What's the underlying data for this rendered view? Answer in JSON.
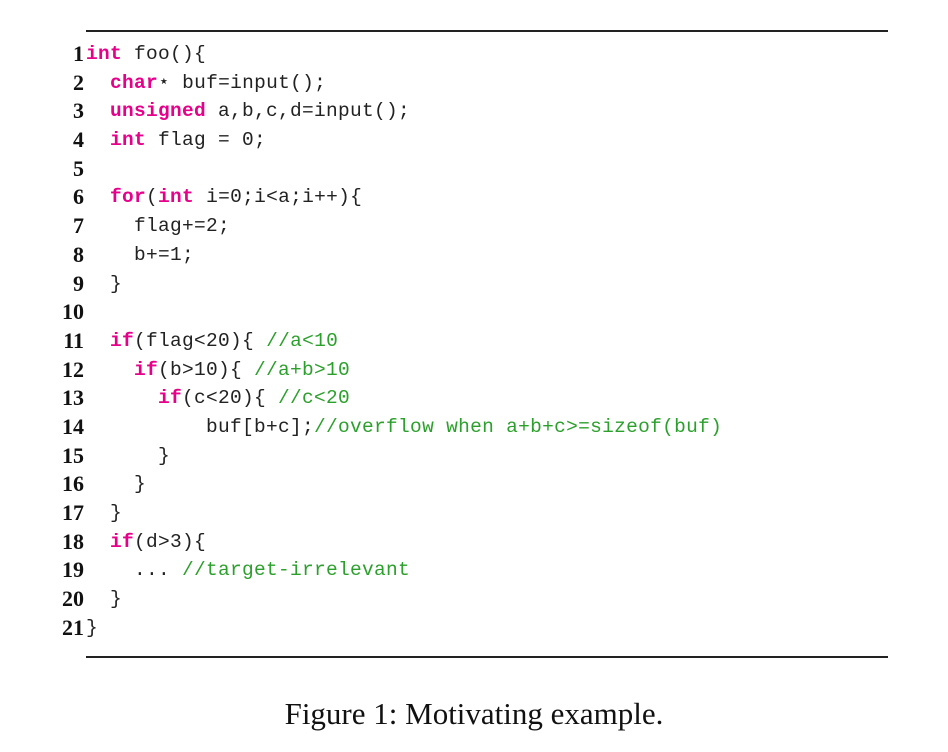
{
  "figure": {
    "caption": "Figure 1: Motivating example.",
    "colors": {
      "keyword": "#e6008a",
      "comment": "#2ca02c",
      "text": "#222222"
    },
    "code_lines": [
      {
        "n": "1",
        "tokens": [
          {
            "t": "int",
            "k": "kw"
          },
          {
            "t": " foo(){",
            "k": ""
          }
        ]
      },
      {
        "n": "2",
        "tokens": [
          {
            "t": "  ",
            "k": ""
          },
          {
            "t": "char",
            "k": "kw"
          },
          {
            "t": "⋆ buf=input();",
            "k": ""
          }
        ]
      },
      {
        "n": "3",
        "tokens": [
          {
            "t": "  ",
            "k": ""
          },
          {
            "t": "unsigned",
            "k": "kw"
          },
          {
            "t": " a,b,c,d=input();",
            "k": ""
          }
        ]
      },
      {
        "n": "4",
        "tokens": [
          {
            "t": "  ",
            "k": ""
          },
          {
            "t": "int",
            "k": "kw"
          },
          {
            "t": " flag = 0;",
            "k": ""
          }
        ]
      },
      {
        "n": "5",
        "tokens": []
      },
      {
        "n": "6",
        "tokens": [
          {
            "t": "  ",
            "k": ""
          },
          {
            "t": "for",
            "k": "kw"
          },
          {
            "t": "(",
            "k": ""
          },
          {
            "t": "int",
            "k": "kw"
          },
          {
            "t": " i=0;i<a;i++){",
            "k": ""
          }
        ]
      },
      {
        "n": "7",
        "tokens": [
          {
            "t": "    flag+=2;",
            "k": ""
          }
        ]
      },
      {
        "n": "8",
        "tokens": [
          {
            "t": "    b+=1;",
            "k": ""
          }
        ]
      },
      {
        "n": "9",
        "tokens": [
          {
            "t": "  }",
            "k": ""
          }
        ]
      },
      {
        "n": "10",
        "tokens": []
      },
      {
        "n": "11",
        "tokens": [
          {
            "t": "  ",
            "k": ""
          },
          {
            "t": "if",
            "k": "kw"
          },
          {
            "t": "(flag<20){ ",
            "k": ""
          },
          {
            "t": "//a<10",
            "k": "cm"
          }
        ]
      },
      {
        "n": "12",
        "tokens": [
          {
            "t": "    ",
            "k": ""
          },
          {
            "t": "if",
            "k": "kw"
          },
          {
            "t": "(b>10){ ",
            "k": ""
          },
          {
            "t": "//a+b>10",
            "k": "cm"
          }
        ]
      },
      {
        "n": "13",
        "tokens": [
          {
            "t": "      ",
            "k": ""
          },
          {
            "t": "if",
            "k": "kw"
          },
          {
            "t": "(c<20){ ",
            "k": ""
          },
          {
            "t": "//c<20",
            "k": "cm"
          }
        ]
      },
      {
        "n": "14",
        "tokens": [
          {
            "t": "          buf[b+c];",
            "k": ""
          },
          {
            "t": "//overflow when a+b+c>=sizeof(buf)",
            "k": "cm"
          }
        ]
      },
      {
        "n": "15",
        "tokens": [
          {
            "t": "      }",
            "k": ""
          }
        ]
      },
      {
        "n": "16",
        "tokens": [
          {
            "t": "    }",
            "k": ""
          }
        ]
      },
      {
        "n": "17",
        "tokens": [
          {
            "t": "  }",
            "k": ""
          }
        ]
      },
      {
        "n": "18",
        "tokens": [
          {
            "t": "  ",
            "k": ""
          },
          {
            "t": "if",
            "k": "kw"
          },
          {
            "t": "(d>3){",
            "k": ""
          }
        ]
      },
      {
        "n": "19",
        "tokens": [
          {
            "t": "    ... ",
            "k": ""
          },
          {
            "t": "//target-irrelevant",
            "k": "cm"
          }
        ]
      },
      {
        "n": "20",
        "tokens": [
          {
            "t": "  }",
            "k": ""
          }
        ]
      },
      {
        "n": "21",
        "tokens": [
          {
            "t": "}",
            "k": ""
          }
        ]
      }
    ]
  }
}
